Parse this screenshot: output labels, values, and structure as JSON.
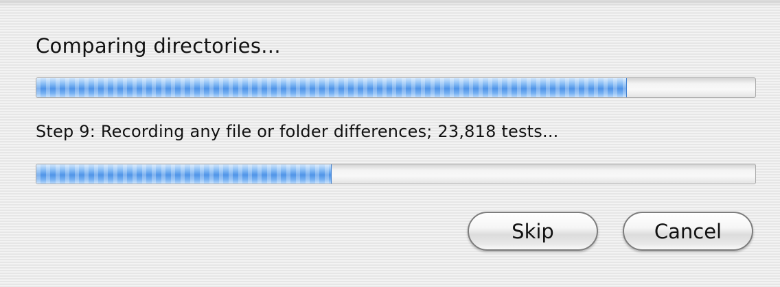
{
  "dialog": {
    "title": "Comparing directories...",
    "overall_progress": {
      "value": 0.82
    },
    "step_text": "Step 9: Recording any file or folder differences; 23,818 tests...",
    "step_progress": {
      "value": 0.41
    },
    "buttons": {
      "skip_label": "Skip",
      "cancel_label": "Cancel"
    }
  },
  "colors": {
    "progress_fill": "#4f94e8",
    "background": "#ececec",
    "text": "#111111"
  }
}
